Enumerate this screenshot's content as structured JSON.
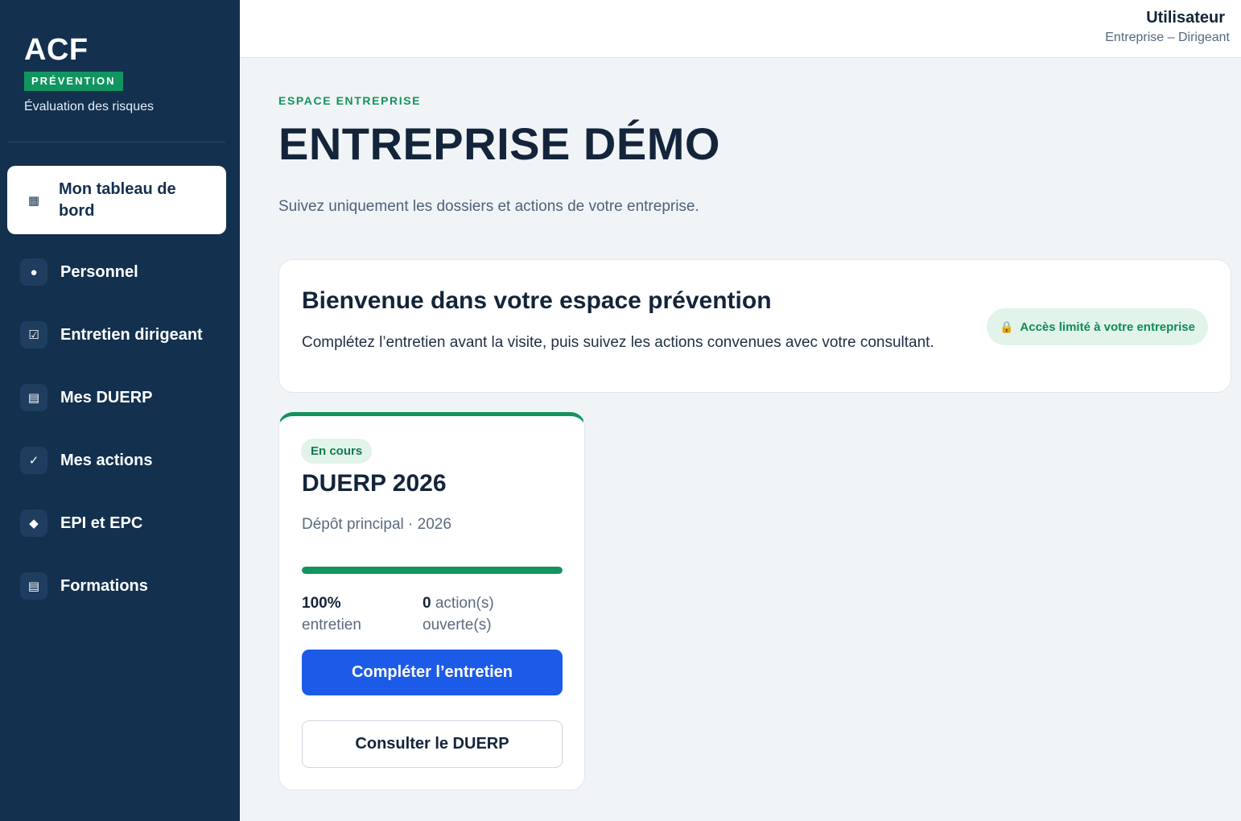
{
  "brand": {
    "name": "ACF",
    "badge": "PRÉVENTION",
    "subtitle": "Évaluation des risques"
  },
  "sidebar": {
    "items": [
      {
        "label": "Mon tableau de bord",
        "icon": "grid-icon",
        "glyph": "▦",
        "active": true
      },
      {
        "label": "Personnel",
        "icon": "dot-icon",
        "glyph": "●",
        "active": false
      },
      {
        "label": "Entretien dirigeant",
        "icon": "checkbox-icon",
        "glyph": "☑",
        "active": false
      },
      {
        "label": "Mes DUERP",
        "icon": "document-icon",
        "glyph": "▤",
        "active": false
      },
      {
        "label": "Mes actions",
        "icon": "check-icon",
        "glyph": "✓",
        "active": false
      },
      {
        "label": "EPI et EPC",
        "icon": "diamond-icon",
        "glyph": "◆",
        "active": false
      },
      {
        "label": "Formations",
        "icon": "list-icon",
        "glyph": "▤",
        "active": false
      }
    ]
  },
  "header": {
    "user_name": "Utilisateur",
    "user_role": "Entreprise – Dirigeant"
  },
  "main": {
    "eyebrow": "ESPACE ENTREPRISE",
    "title": "ENTREPRISE DÉMO",
    "subtitle": "Suivez uniquement les dossiers et actions de votre entreprise."
  },
  "welcome": {
    "title": "Bienvenue dans votre espace prévention",
    "text": "Complétez l’entretien avant la visite, puis suivez les actions convenues avec votre consultant.",
    "pill_icon": "🔒",
    "pill_label": "Accès limité à votre entreprise"
  },
  "card": {
    "status": "En cours",
    "title": "DUERP 2026",
    "subtitle": "Dépôt principal · 2026",
    "progress": 1.0,
    "stat1_value": "100%",
    "stat1_label": "entretien",
    "stat2_value": "0",
    "stat2_label": "action(s) ouverte(s)",
    "primary_button": "Compléter l’entretien",
    "secondary_button": "Consulter le DUERP"
  },
  "colors": {
    "sidebar": "#13304f",
    "accent_green": "#13935d",
    "primary_blue": "#1c5be8"
  }
}
